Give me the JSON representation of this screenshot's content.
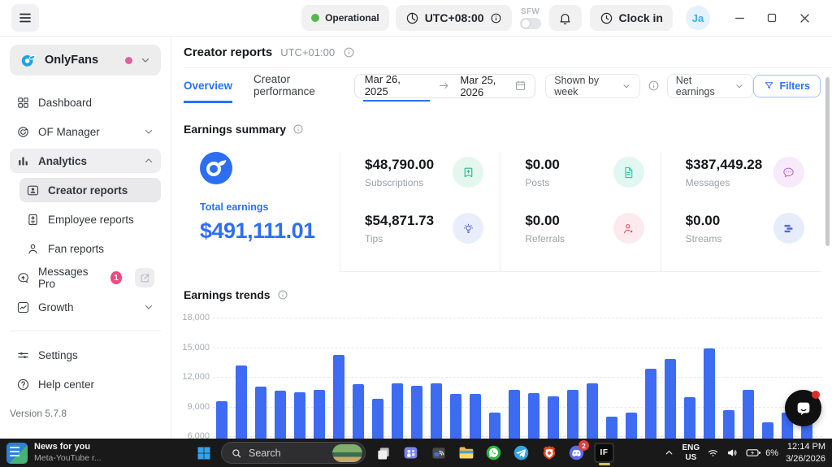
{
  "topbar": {
    "status": "Operational",
    "timezone": "UTC+08:00",
    "sfw_label": "SFW",
    "clock_in_label": "Clock in",
    "avatar_initials": "Ja"
  },
  "sidebar": {
    "workspace_name": "OnlyFans",
    "items": [
      {
        "label": "Dashboard",
        "icon": "grid"
      },
      {
        "label": "OF Manager",
        "icon": "of-manager",
        "chevron": "down"
      },
      {
        "label": "Analytics",
        "icon": "analytics",
        "chevron": "up",
        "expanded": true
      },
      {
        "label": "Creator reports",
        "icon": "contact-card",
        "sub": true,
        "selected": true
      },
      {
        "label": "Employee reports",
        "icon": "id-card",
        "sub": true
      },
      {
        "label": "Fan reports",
        "icon": "person",
        "sub": true
      },
      {
        "label": "Messages Pro",
        "icon": "message-pro",
        "badge": "1",
        "external": true
      },
      {
        "label": "Growth",
        "icon": "growth",
        "chevron": "down"
      },
      {
        "divider": true
      },
      {
        "label": "Settings",
        "icon": "sliders"
      },
      {
        "label": "Help center",
        "icon": "help"
      }
    ],
    "version": "Version 5.7.8"
  },
  "header": {
    "title": "Creator reports",
    "timezone": "UTC+01:00"
  },
  "tabs": [
    {
      "label": "Overview",
      "active": true
    },
    {
      "label": "Creator performance",
      "active": false
    }
  ],
  "toolbar": {
    "date_start": "Mar 26, 2025",
    "date_end": "Mar 25, 2026",
    "group_by": "Shown by week",
    "metric": "Net earnings",
    "filters_label": "Filters"
  },
  "summary": {
    "title": "Earnings summary",
    "total_label": "Total earnings",
    "total_value": "$491,111.01",
    "accent": "#2f6df5",
    "stats": [
      {
        "label": "Subscriptions",
        "value": "$48,790.00",
        "icon": "bookmark-plus",
        "fg": "#2bb787",
        "bg": "#e4f7ef"
      },
      {
        "label": "Tips",
        "value": "$54,871.73",
        "icon": "bulb",
        "fg": "#5a6bd8",
        "bg": "#eaedfb"
      },
      {
        "label": "Posts",
        "value": "$0.00",
        "icon": "document",
        "fg": "#2fc8a0",
        "bg": "#e1f8f2"
      },
      {
        "label": "Referrals",
        "value": "$0.00",
        "icon": "person-star",
        "fg": "#e0556e",
        "bg": "#fceaee"
      },
      {
        "label": "Messages",
        "value": "$387,449.28",
        "icon": "chat-dots",
        "fg": "#c16fd6",
        "bg": "#f7eafb"
      },
      {
        "label": "Streams",
        "value": "$0.00",
        "icon": "stream-bars",
        "fg": "#4d69d8",
        "bg": "#e7ecfa"
      }
    ],
    "column_pairs": [
      [
        0,
        1
      ],
      [
        2,
        3
      ],
      [
        4,
        5
      ]
    ]
  },
  "trends": {
    "title": "Earnings trends"
  },
  "chart_data": {
    "type": "bar",
    "title": "Earnings trends",
    "x_unit": "week",
    "values": [
      9600,
      13170,
      11030,
      10670,
      10480,
      10720,
      14260,
      11250,
      9800,
      11360,
      11100,
      11360,
      10340,
      10280,
      8420,
      10700,
      10360,
      10090,
      10710,
      11330,
      8020,
      8380,
      12820,
      13850,
      10000,
      14930,
      8650,
      10680,
      7460,
      8400,
      8970
    ],
    "yticks": [
      18000,
      15000,
      12000,
      9000,
      6000
    ],
    "ylim_top": 18490,
    "ylim_bottom": 4730,
    "bar_color": "#3d6cf2",
    "grid": "dashed-horizontal",
    "legend": "none"
  },
  "taskbar": {
    "news_title": "News for you",
    "news_subtitle": "Meta-YouTube r...",
    "search_placeholder": "Search",
    "apps": [
      {
        "name": "task-view"
      },
      {
        "name": "teams"
      },
      {
        "name": "nearby-share"
      },
      {
        "name": "file-explorer"
      },
      {
        "name": "whatsapp"
      },
      {
        "name": "telegram"
      },
      {
        "name": "brave"
      },
      {
        "name": "discord",
        "badge": "2"
      },
      {
        "name": "if-app",
        "label": "IF",
        "active": true
      }
    ],
    "tray": {
      "lang_line1": "ENG",
      "lang_line2": "US",
      "battery": "6%",
      "time": "12:14 PM",
      "date": "3/26/2026"
    }
  }
}
